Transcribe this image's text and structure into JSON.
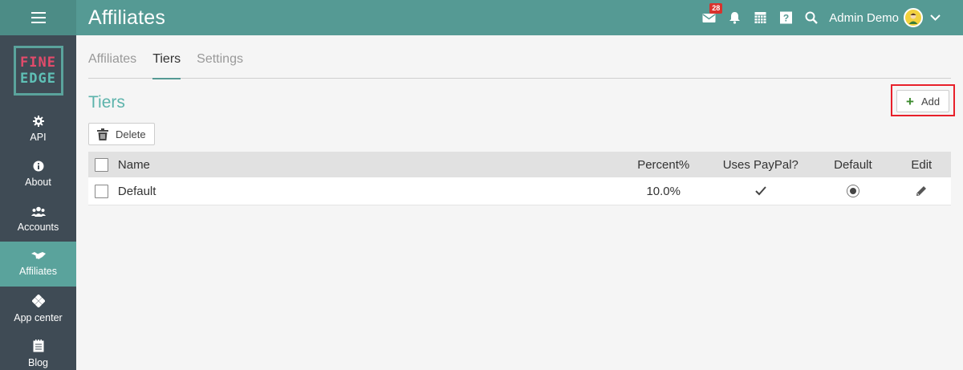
{
  "header": {
    "title": "Affiliates",
    "notification_count": "28",
    "user_name": "Admin Demo",
    "icons": [
      "menu-icon",
      "envelope-icon",
      "bell-icon",
      "calendar-icon",
      "help-icon",
      "search-icon",
      "avatar",
      "chevron-down-icon"
    ]
  },
  "sidebar": {
    "logo_line1": "FINE",
    "logo_line2": "EDGE",
    "items": [
      {
        "label": "API",
        "icon": "gear-icon"
      },
      {
        "label": "About",
        "icon": "info-icon"
      },
      {
        "label": "Accounts",
        "icon": "users-icon"
      },
      {
        "label": "Affiliates",
        "icon": "handshake-icon",
        "active": true
      },
      {
        "label": "App center",
        "icon": "apps-icon"
      },
      {
        "label": "Blog",
        "icon": "blog-icon"
      }
    ]
  },
  "tabs": [
    {
      "label": "Affiliates"
    },
    {
      "label": "Tiers",
      "active": true
    },
    {
      "label": "Settings"
    }
  ],
  "section": {
    "title": "Tiers",
    "add_label": "Add",
    "delete_label": "Delete"
  },
  "table": {
    "columns": {
      "name": "Name",
      "percent": "Percent%",
      "paypal": "Uses PayPal?",
      "default": "Default",
      "edit": "Edit"
    },
    "rows": [
      {
        "name": "Default",
        "percent": "10.0%",
        "uses_paypal": true,
        "is_default": true
      }
    ]
  },
  "colors": {
    "header": "#559a94",
    "sidebar": "#3f4b55",
    "accent": "#5cb3ab",
    "highlight": "#e8202a",
    "badge": "#d9322d"
  }
}
